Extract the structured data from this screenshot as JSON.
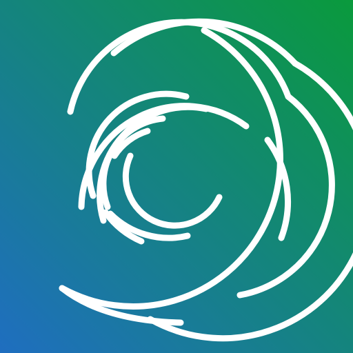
{
  "icon": {
    "name": "concentric-spiral-logo",
    "gradient": {
      "top_right": "#0a9a3c",
      "bottom_left": "#1f6ec0"
    },
    "stroke_color": "#ffffff"
  }
}
